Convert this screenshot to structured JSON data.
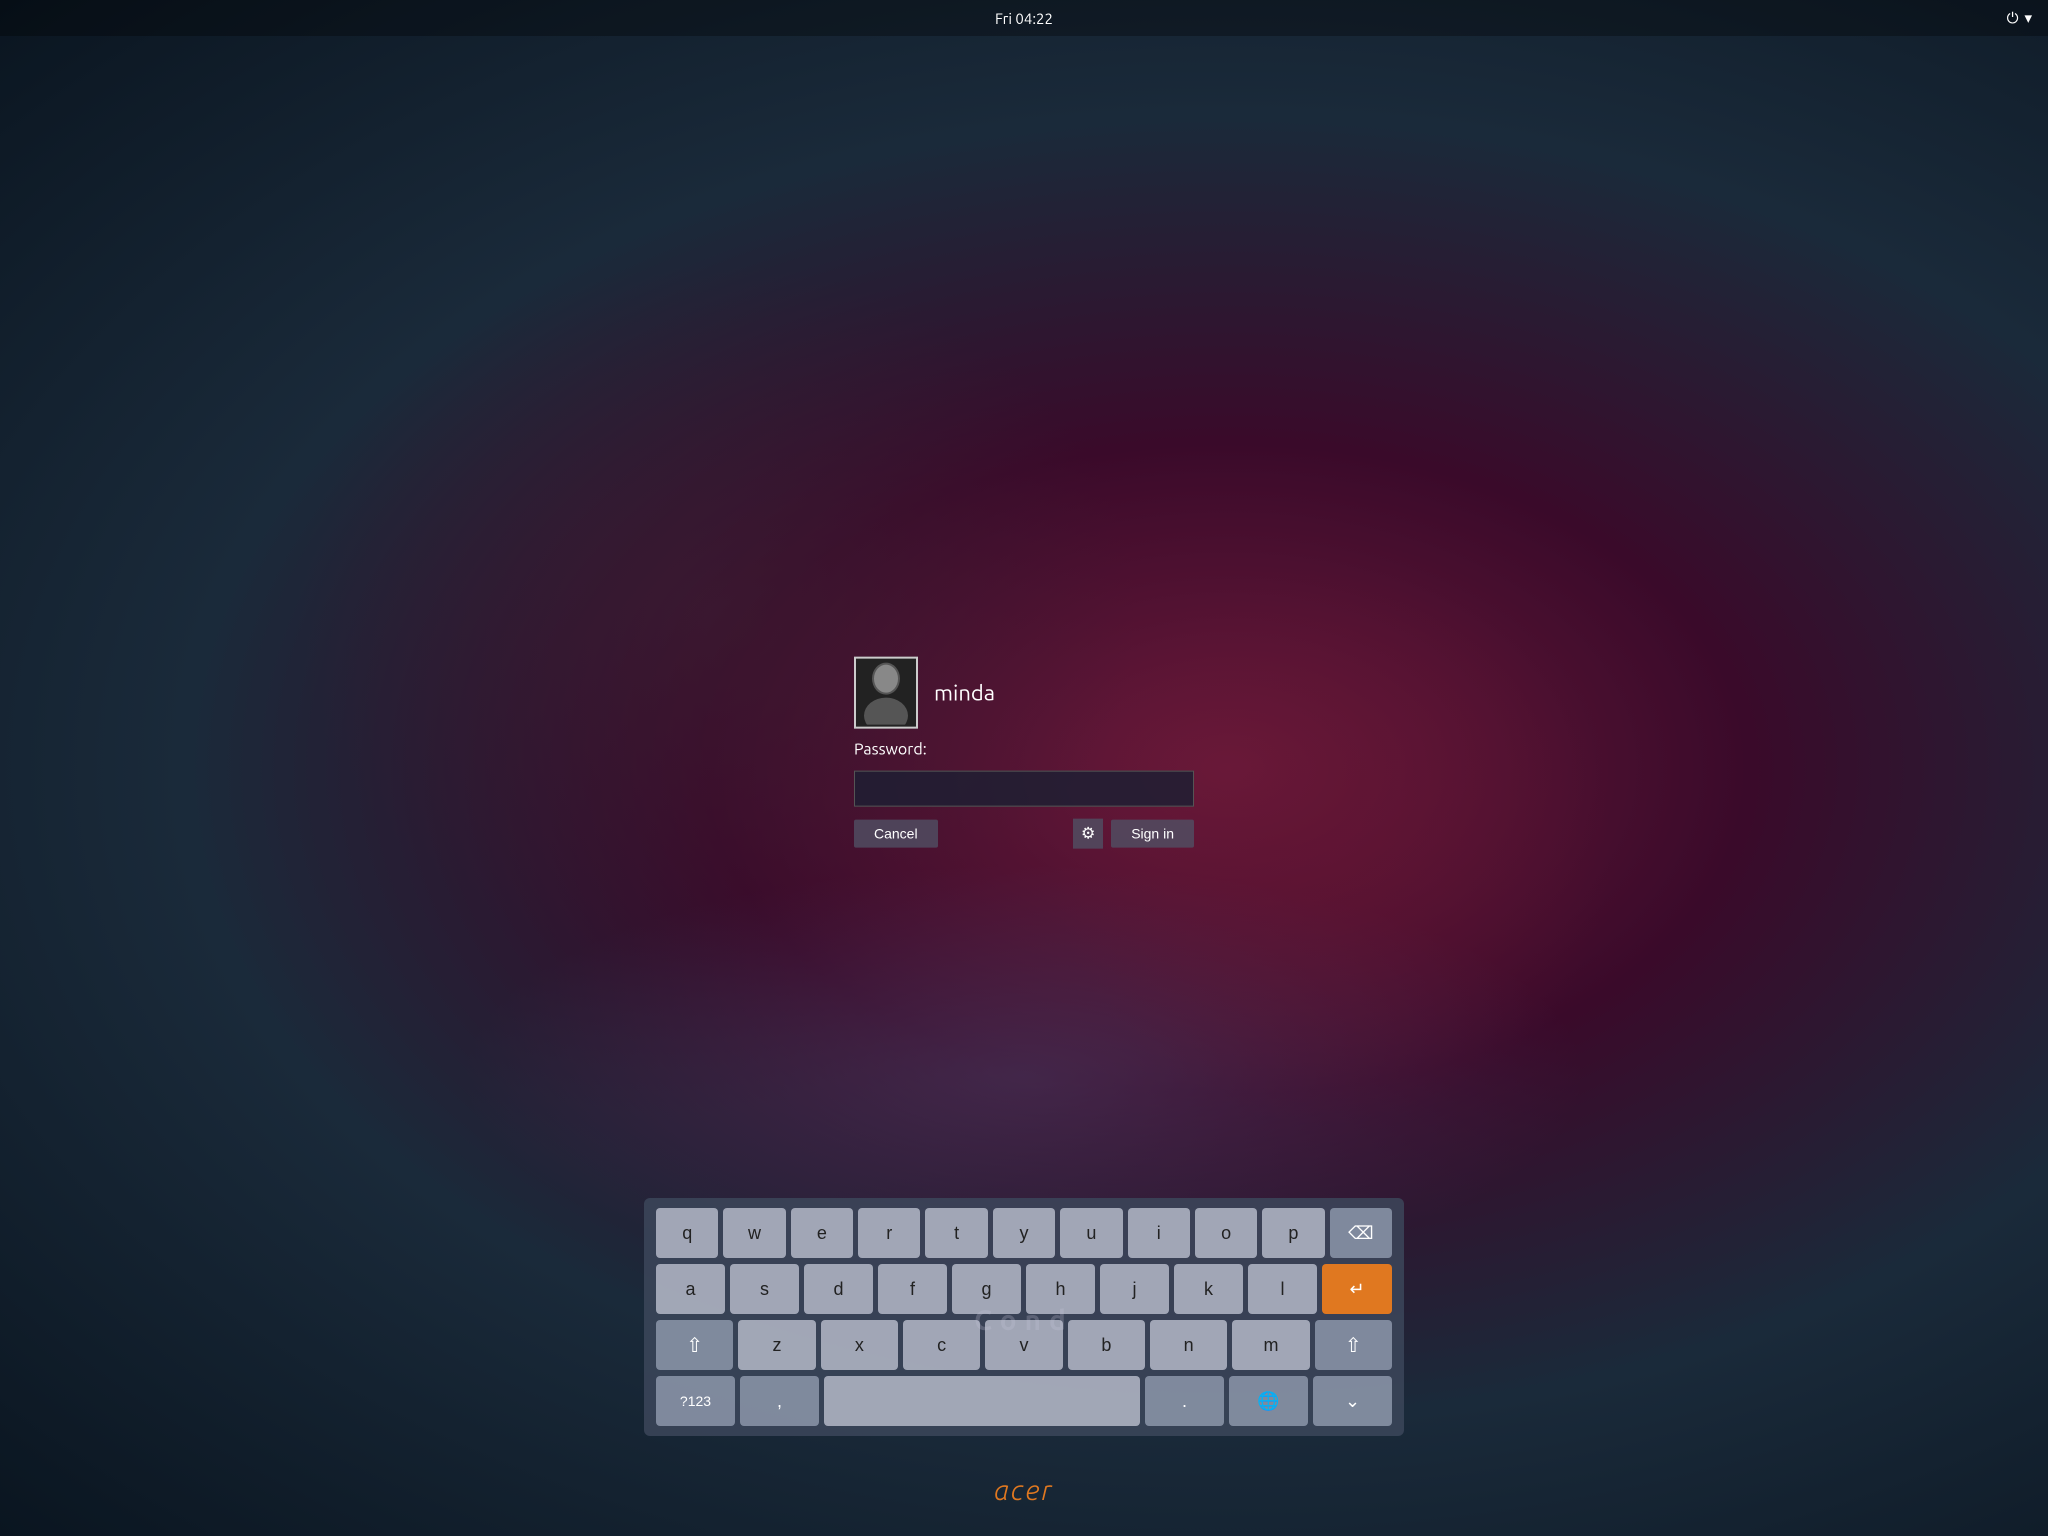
{
  "topbar": {
    "datetime": "Fri 04:22",
    "power_icon": "⏻"
  },
  "login": {
    "username": "minda",
    "password_label": "Password:",
    "password_value": "",
    "password_placeholder": "",
    "cancel_label": "Cancel",
    "signin_label": "Sign in"
  },
  "keyboard": {
    "rows": [
      [
        "q",
        "w",
        "e",
        "r",
        "t",
        "y",
        "u",
        "i",
        "o",
        "p"
      ],
      [
        "a",
        "s",
        "d",
        "f",
        "g",
        "h",
        "j",
        "k",
        "l"
      ],
      [
        "z",
        "x",
        "c",
        "v",
        "b",
        "n",
        "m"
      ]
    ],
    "numbers_label": "?123",
    "backspace_char": "⌫",
    "enter_char": "↵",
    "shift_char": "⇧",
    "space_label": "",
    "hide_label": "⌄",
    "lang_label": "🌐"
  },
  "watermark": "Cond",
  "brand": "acer"
}
